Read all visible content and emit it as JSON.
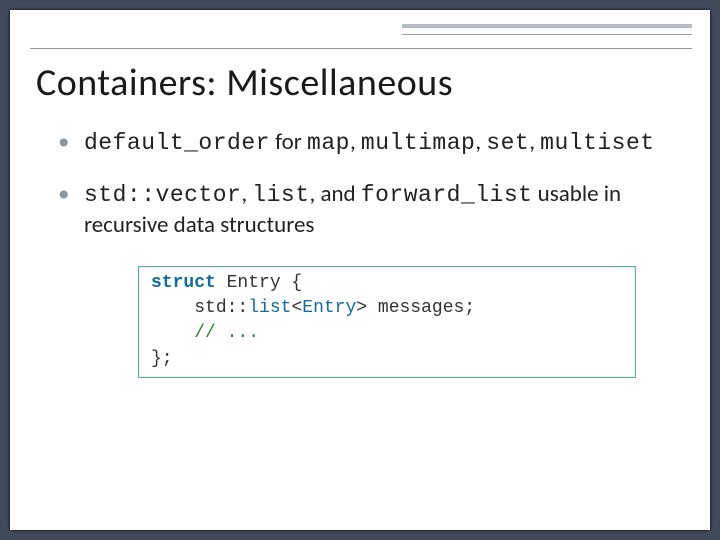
{
  "slide": {
    "title": "Containers: Miscellaneous",
    "bullets": [
      {
        "p1": "default_order",
        "p2": " for ",
        "p3": "map",
        "p4": ", ",
        "p5": "multimap",
        "p6": ", ",
        "p7": "set",
        "p8": ", ",
        "p9": "multiset"
      },
      {
        "p1": "std::vector",
        "p2": ", ",
        "p3": "list",
        "p4": ", and ",
        "p5": "forward_list",
        "p6": " usable in recursive data structures"
      }
    ],
    "code": {
      "kw_struct": "struct",
      "struct_name": " Entry {",
      "indent": "    ",
      "member_prefix": "std::",
      "list_type": "list",
      "template_open": "<",
      "template_arg": "Entry",
      "template_close": ">",
      "member_suffix": " messages;",
      "comment": "// ...",
      "close": "};"
    }
  }
}
